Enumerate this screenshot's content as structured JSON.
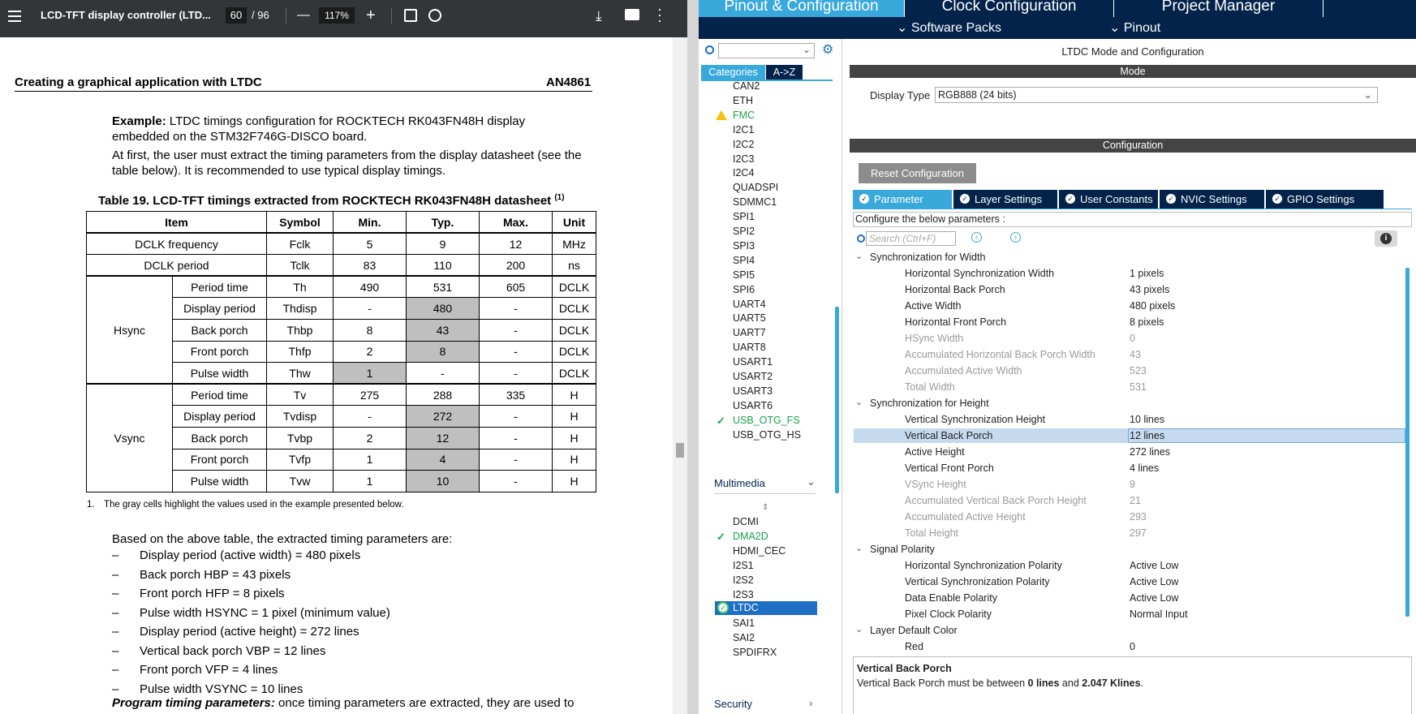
{
  "pdf": {
    "menu_icon": "menu-icon",
    "title": "LCD-TFT display controller (LTD...",
    "page_current": "60",
    "page_total": "/ 96",
    "zoom": "117%",
    "zoom_out": "—",
    "zoom_in": "+",
    "header_left": "Creating a graphical application with LTDC",
    "header_right": "AN4861",
    "example_bold": "Example:",
    "example_text_1": " LTDC timings configuration for ROCKTECH RK043FN48H display",
    "example_text_2": "embedded on the STM32F746G-DISCO board.",
    "para_1": "At first, the user must extract the timing parameters from the display datasheet (see the",
    "para_2": "table below). It is recommended to use typical display timings.",
    "table_caption": "Table 19. LCD-TFT timings extracted from ROCKTECH RK043FN48H datasheet",
    "table_caption_sup": "(1)",
    "table_headers": [
      "Item",
      "Symbol",
      "Min.",
      "Typ.",
      "Max.",
      "Unit"
    ],
    "rows": [
      {
        "item": "DCLK frequency",
        "symbol": "Fclk",
        "min": "5",
        "typ": "9",
        "max": "12",
        "unit": "MHz"
      },
      {
        "item": "DCLK period",
        "symbol": "Tclk",
        "min": "83",
        "typ": "110",
        "max": "200",
        "unit": "ns"
      }
    ],
    "hsync_label": "Hsync",
    "hsync_rows": [
      {
        "item": "Period time",
        "symbol": "Th",
        "min": "490",
        "typ": "531",
        "max": "605",
        "unit": "DCLK"
      },
      {
        "item": "Display period",
        "symbol": "Thdisp",
        "min": "-",
        "typ": "480",
        "max": "-",
        "unit": "DCLK"
      },
      {
        "item": "Back porch",
        "symbol": "Thbp",
        "min": "8",
        "typ": "43",
        "max": "-",
        "unit": "DCLK"
      },
      {
        "item": "Front porch",
        "symbol": "Thfp",
        "min": "2",
        "typ": "8",
        "max": "-",
        "unit": "DCLK"
      },
      {
        "item": "Pulse width",
        "symbol": "Thw",
        "min": "1",
        "typ": "-",
        "max": "-",
        "unit": "DCLK"
      }
    ],
    "vsync_label": "Vsync",
    "vsync_rows": [
      {
        "item": "Period time",
        "symbol": "Tv",
        "min": "275",
        "typ": "288",
        "max": "335",
        "unit": "H"
      },
      {
        "item": "Display period",
        "symbol": "Tvdisp",
        "min": "-",
        "typ": "272",
        "max": "-",
        "unit": "H"
      },
      {
        "item": "Back porch",
        "symbol": "Tvbp",
        "min": "2",
        "typ": "12",
        "max": "-",
        "unit": "H"
      },
      {
        "item": "Front porch",
        "symbol": "Tvfp",
        "min": "1",
        "typ": "4",
        "max": "-",
        "unit": "H"
      },
      {
        "item": "Pulse width",
        "symbol": "Tvw",
        "min": "1",
        "typ": "10",
        "max": "-",
        "unit": "H"
      }
    ],
    "footnote_num": "1.",
    "footnote": "The gray cells highlight the values used in the example presented below.",
    "based_on": "Based on the above table, the extracted timing parameters are:",
    "bullets": [
      "Display period (active width) = 480 pixels",
      "Back porch HBP = 43 pixels",
      "Front porch HFP = 8 pixels",
      "Pulse width HSYNC = 1 pixel (minimum value)",
      "Display period (active height) = 272 lines",
      "Vertical back porch VBP = 12 lines",
      "Front porch VFP = 4 lines",
      "Pulse width VSYNC = 10 lines"
    ],
    "bullet_dash": "–",
    "program_bold": "Program timing parameters:",
    "program_text": " once timing parameters are extracted, they are used to"
  },
  "cube": {
    "tabs": [
      "Pinout & Configuration",
      "Clock Configuration",
      "Project Manager",
      "Pinout"
    ],
    "software_packs": "Software Packs",
    "pinout_sub": "Pinout",
    "categories_tab": "Categories",
    "az_tab": "A->Z",
    "cat_items": [
      "CAN2",
      "ETH",
      "FMC",
      "I2C1",
      "I2C2",
      "I2C3",
      "I2C4",
      "QUADSPI",
      "SDMMC1",
      "SPI1",
      "SPI2",
      "SPI3",
      "SPI4",
      "SPI5",
      "SPI6",
      "UART4",
      "UART5",
      "UART7",
      "UART8",
      "USART1",
      "USART2",
      "USART3",
      "USART6",
      "USB_OTG_FS",
      "USB_OTG_HS"
    ],
    "multimedia": "Multimedia",
    "mm_items": [
      "DCMI",
      "DMA2D",
      "HDMI_CEC",
      "I2S1",
      "I2S2",
      "I2S3",
      "LTDC",
      "SAI1",
      "SAI2",
      "SPDIFRX"
    ],
    "security": "Security",
    "mode_title": "LTDC Mode and Configuration",
    "mode_bar": "Mode",
    "display_type_label": "Display Type",
    "display_type_value": "RGB888 (24 bits)",
    "config_bar": "Configuration",
    "reset_btn": "Reset Configuration",
    "ptabs": [
      "Parameter Settings",
      "Layer Settings",
      "User Constants",
      "NVIC Settings",
      "GPIO Settings"
    ],
    "configure_text": "Configure the below parameters :",
    "search_placeholder": "Search (Ctrl+F)",
    "groups": {
      "width": "Synchronization for Width",
      "height": "Synchronization for Height",
      "polarity": "Signal Polarity",
      "layer": "Layer Default Color"
    },
    "params_width": [
      {
        "name": "Horizontal Synchronization Width",
        "value": "1 pixels"
      },
      {
        "name": "Horizontal Back Porch",
        "value": "43 pixels"
      },
      {
        "name": "Active Width",
        "value": "480 pixels"
      },
      {
        "name": "Horizontal Front Porch",
        "value": "8 pixels"
      },
      {
        "name": "HSync Width",
        "value": "0"
      },
      {
        "name": "Accumulated Horizontal Back Porch Width",
        "value": "43"
      },
      {
        "name": "Accumulated Active Width",
        "value": "523"
      },
      {
        "name": "Total Width",
        "value": "531"
      }
    ],
    "params_height": [
      {
        "name": "Vertical Synchronization Height",
        "value": "10 lines"
      },
      {
        "name": "Vertical Back Porch",
        "value": "12 lines"
      },
      {
        "name": "Active Height",
        "value": "272 lines"
      },
      {
        "name": "Vertical Front Porch",
        "value": "4 lines"
      },
      {
        "name": "VSync Height",
        "value": "9"
      },
      {
        "name": "Accumulated Vertical Back Porch Height",
        "value": "21"
      },
      {
        "name": "Accumulated Active Height",
        "value": "293"
      },
      {
        "name": "Total Height",
        "value": "297"
      }
    ],
    "params_polarity": [
      {
        "name": "Horizontal Synchronization Polarity",
        "value": "Active Low"
      },
      {
        "name": "Vertical Synchronization Polarity",
        "value": "Active Low"
      },
      {
        "name": "Data Enable Polarity",
        "value": "Active Low"
      },
      {
        "name": "Pixel Clock Polarity",
        "value": "Normal Input"
      }
    ],
    "params_layer": [
      {
        "name": "Red",
        "value": "0"
      }
    ],
    "desc_title": "Vertical Back Porch",
    "desc_pre": "Vertical Back Porch must be between ",
    "desc_b1": "0 lines",
    "desc_mid": " and ",
    "desc_b2": "2.047 Klines",
    "desc_post": "."
  }
}
